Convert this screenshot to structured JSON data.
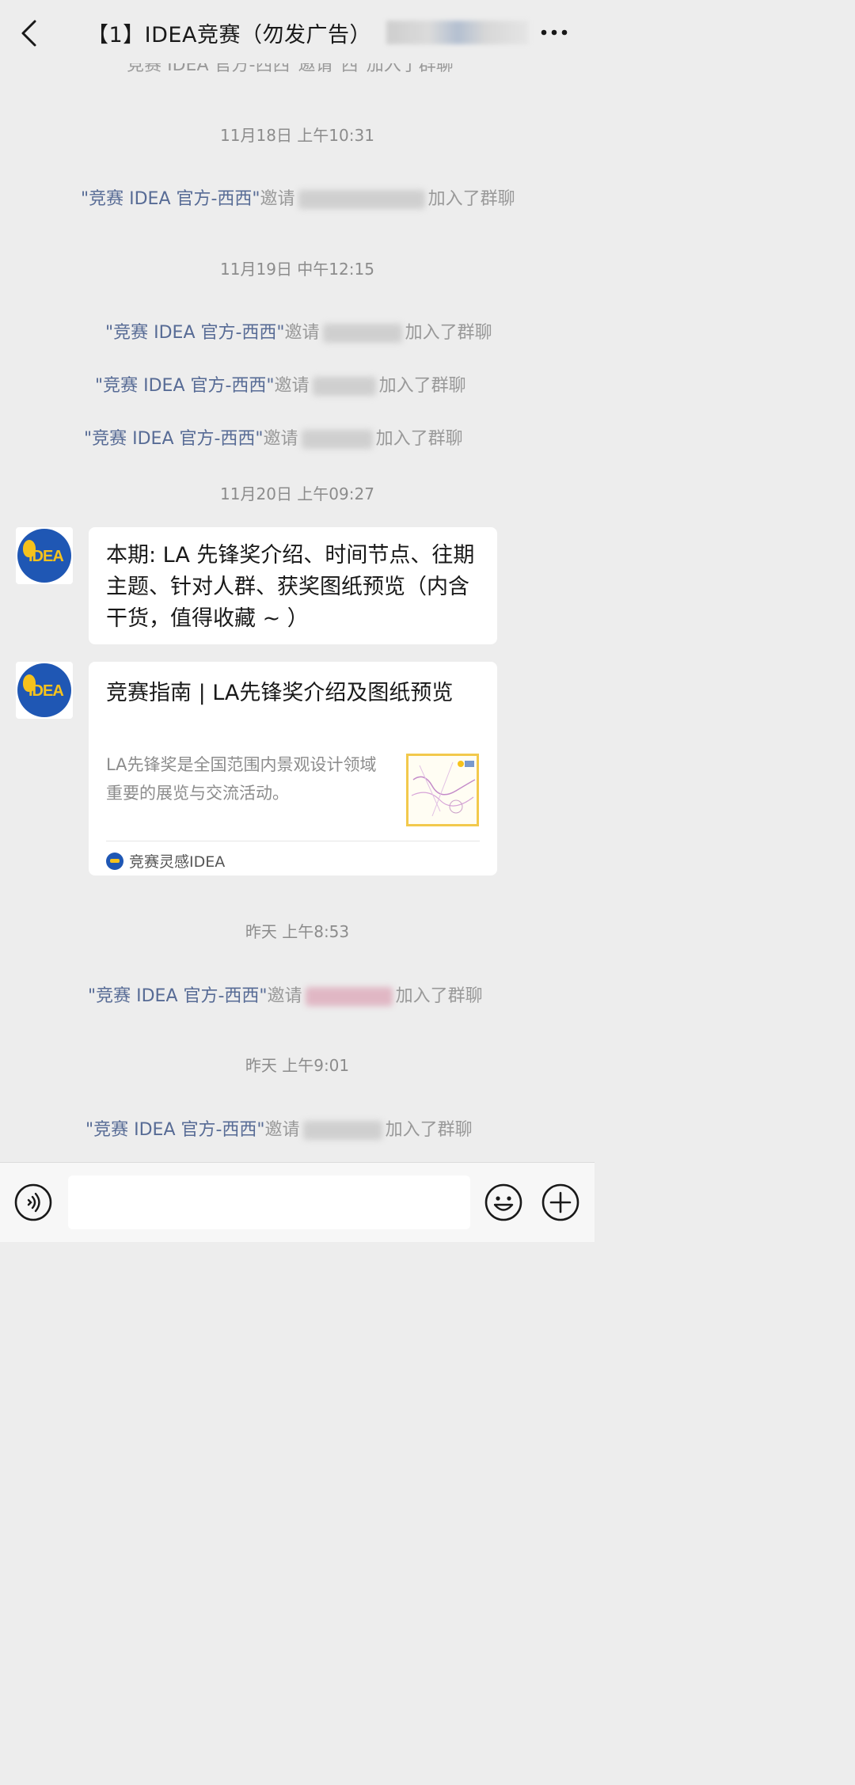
{
  "header": {
    "title": "【1】IDEA竞赛（勿发广告）"
  },
  "messages": {
    "partial_top": "\"竞赛 IDEA 官方-西西\"邀请\"西\"加入了群聊",
    "t1": "11月18日 上午10:31",
    "t2": "11月19日 中午12:15",
    "t3": "11月20日 上午09:27",
    "t4": "昨天 上午8:53",
    "t5": "昨天 上午9:01",
    "inviter": "\"竞赛 IDEA 官方-西西\"",
    "invite_word": "邀请",
    "joined": "加入了群聊",
    "text_msg": "本期: LA 先锋奖介绍、时间节点、往期主题、针对人群、获奖图纸预览（内含干货，值得收藏 ~ ）",
    "card": {
      "title": "竞赛指南 | LA先锋奖介绍及图纸预览",
      "desc": "LA先锋奖是全国范围内景观设计领域重要的展览与交流活动。",
      "source": "竞赛灵感IDEA"
    }
  },
  "avatar": {
    "text": "IDEA"
  },
  "icons": {
    "back": "chevron-left-icon",
    "more": "more-dots-icon",
    "voice": "voice-icon",
    "emoji": "emoji-icon",
    "plus": "plus-icon"
  },
  "colors": {
    "background": "#ededed",
    "link": "#576b95",
    "avatar_blue": "#1f57b4",
    "avatar_yellow": "#f6c21c"
  }
}
